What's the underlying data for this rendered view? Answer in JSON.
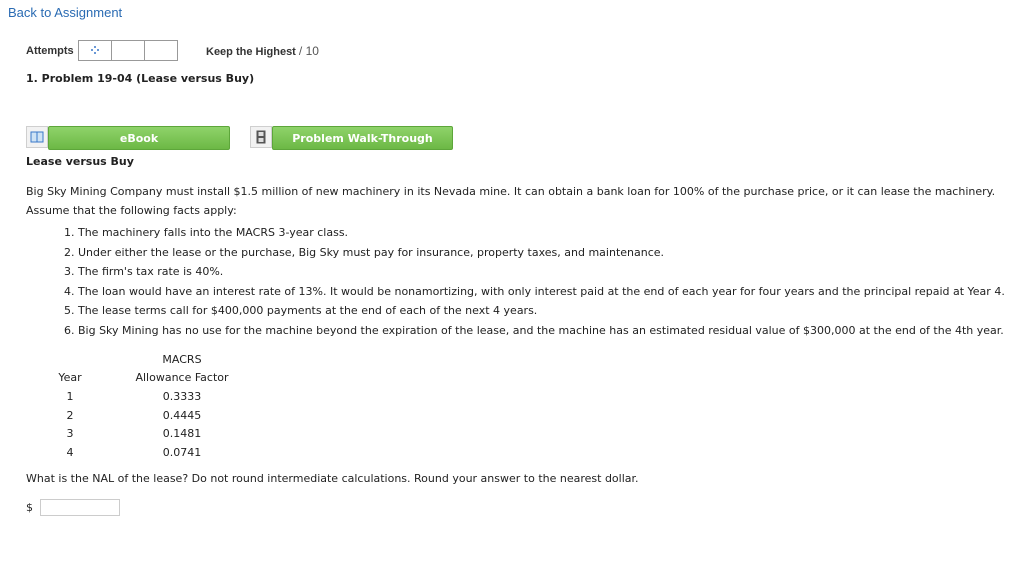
{
  "nav": {
    "back_label": "Back to Assignment"
  },
  "attempts": {
    "label": "Attempts",
    "keep_label": "Keep the Highest",
    "keep_max": "/ 10"
  },
  "problem": {
    "title": "1. Problem 19-04 (Lease versus Buy)"
  },
  "buttons": {
    "ebook": "eBook",
    "walkthrough": "Problem Walk-Through"
  },
  "content": {
    "heading": "Lease versus Buy",
    "intro": "Big Sky Mining Company must install $1.5 million of new machinery in its Nevada mine. It can obtain a bank loan for 100% of the purchase price, or it can lease the machinery. Assume that the following facts apply:",
    "facts": [
      "1. The machinery falls into the MACRS 3-year class.",
      "2. Under either the lease or the purchase, Big Sky must pay for insurance, property taxes, and maintenance.",
      "3. The firm's tax rate is 40%.",
      "4. The loan would have an interest rate of 13%. It would be nonamortizing, with only interest paid at the end of each year for four years and the principal repaid at Year 4.",
      "5. The lease terms call for $400,000 payments at the end of each of the next 4 years.",
      "6. Big Sky Mining has no use for the machine beyond the expiration of the lease, and the machine has an estimated residual value of $300,000 at the end of the 4th year."
    ]
  },
  "macrs_table": {
    "header_top": "MACRS",
    "col_year": "Year",
    "col_factor": "Allowance Factor",
    "rows": [
      {
        "year": "1",
        "factor": "0.3333"
      },
      {
        "year": "2",
        "factor": "0.4445"
      },
      {
        "year": "3",
        "factor": "0.1481"
      },
      {
        "year": "4",
        "factor": "0.0741"
      }
    ]
  },
  "question": {
    "text": "What is the NAL of the lease? Do not round intermediate calculations. Round your answer to the nearest dollar.",
    "currency": "$",
    "answer_value": ""
  },
  "colors": {
    "link": "#2a6bb3",
    "button_green": "#6cb845"
  },
  "icons": {
    "attempts_spinner": "spinner-icon",
    "ebook": "book-icon",
    "walkthrough": "film-icon"
  }
}
